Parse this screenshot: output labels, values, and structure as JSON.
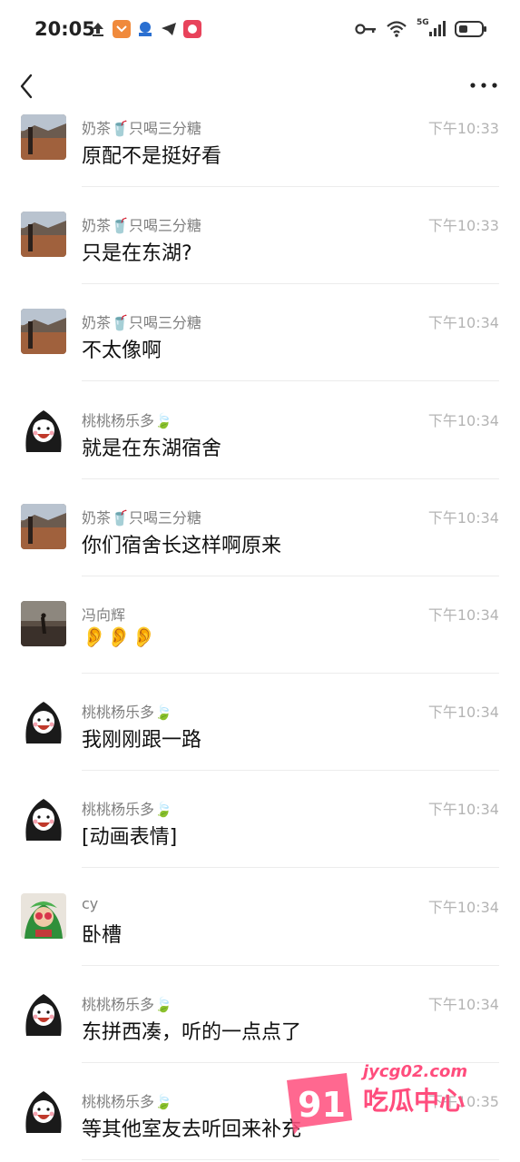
{
  "status_bar": {
    "time": "20:05",
    "network": "5G"
  },
  "nav": {
    "back_icon": "chevron-left-icon",
    "more_icon": "more-dots-icon"
  },
  "messages": [
    {
      "name": "奶茶🥤只喝三分糖",
      "time": "下午10:33",
      "text": "原配不是挺好看",
      "avatar": "landscape"
    },
    {
      "name": "奶茶🥤只喝三分糖",
      "time": "下午10:33",
      "text": "只是在东湖?",
      "avatar": "landscape"
    },
    {
      "name": "奶茶🥤只喝三分糖",
      "time": "下午10:34",
      "text": "不太像啊",
      "avatar": "landscape"
    },
    {
      "name": "桃桃杨乐多🍃",
      "time": "下午10:34",
      "text": "就是在东湖宿舍",
      "avatar": "girl"
    },
    {
      "name": "奶茶🥤只喝三分糖",
      "time": "下午10:34",
      "text": "你们宿舍长这样啊原来",
      "avatar": "landscape"
    },
    {
      "name": "冯向辉",
      "time": "下午10:34",
      "text": "👂👂👂",
      "avatar": "beach"
    },
    {
      "name": "桃桃杨乐多🍃",
      "time": "下午10:34",
      "text": "我刚刚跟一路",
      "avatar": "girl"
    },
    {
      "name": "桃桃杨乐多🍃",
      "time": "下午10:34",
      "text": "[动画表情]",
      "avatar": "girl"
    },
    {
      "name": "cy",
      "time": "下午10:34",
      "text": "卧槽",
      "avatar": "green"
    },
    {
      "name": "桃桃杨乐多🍃",
      "time": "下午10:34",
      "text": "东拼西凑，听的一点点了",
      "avatar": "girl"
    },
    {
      "name": "桃桃杨乐多🍃",
      "time": "下午10:35",
      "text": "等其他室友去听回来补充",
      "avatar": "girl"
    }
  ],
  "watermark": {
    "number": "91",
    "domain": "jycg02.com",
    "label": "吃瓜中心",
    "color": "#ff4d7d"
  }
}
